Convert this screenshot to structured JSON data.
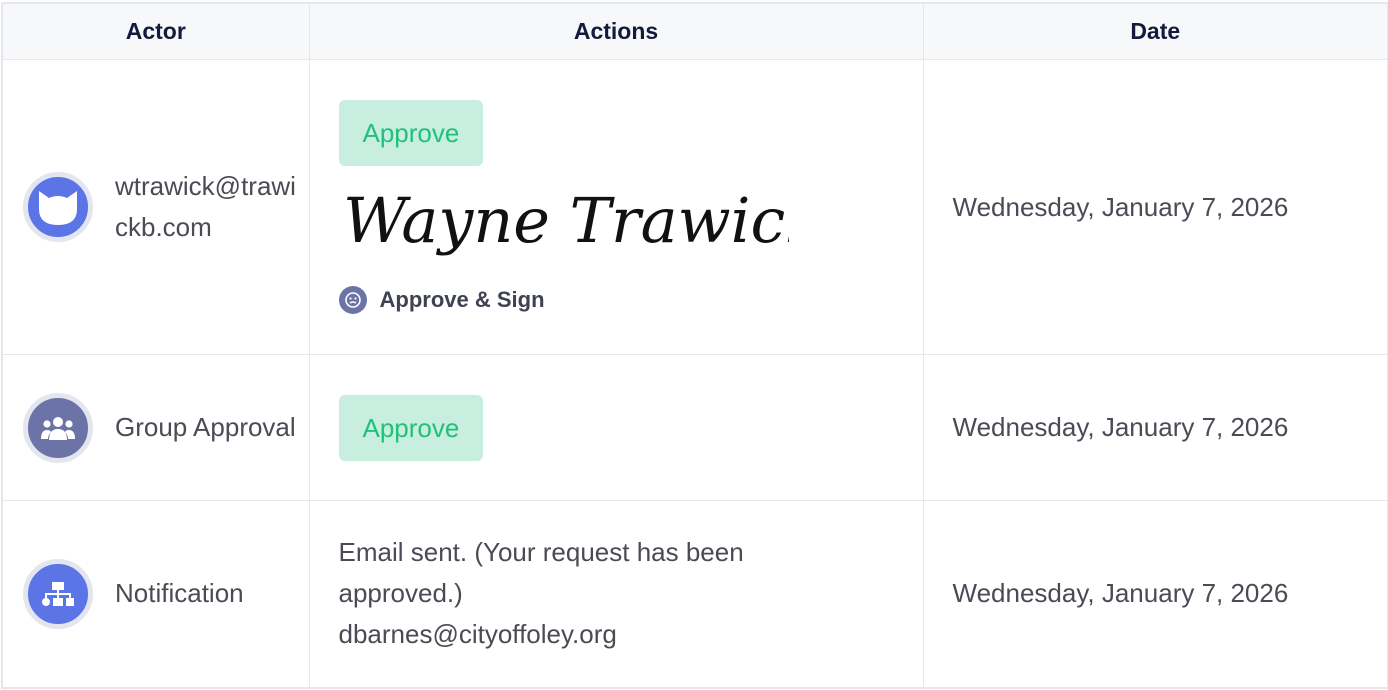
{
  "table": {
    "headers": {
      "actor": "Actor",
      "actions": "Actions",
      "date": "Date"
    },
    "rows": [
      {
        "actor_name": "wtrawick@trawickb.com",
        "actor_icon": "cat-avatar-icon",
        "approve_label": "Approve",
        "signature_text": "Wayne Trawick",
        "approve_sign_label": "Approve & Sign",
        "date": "Wednesday, January 7, 2026"
      },
      {
        "actor_name": "Group Approval",
        "actor_icon": "group-icon",
        "approve_label": "Approve",
        "date": "Wednesday, January 7, 2026"
      },
      {
        "actor_name": "Notification",
        "actor_icon": "sitemap-icon",
        "notification_line1": "Email sent. (Your request has been",
        "notification_line2": "approved.)",
        "notification_line3": "dbarnes@cityoffoley.org",
        "date": "Wednesday, January 7, 2026"
      }
    ]
  },
  "colors": {
    "header_bg": "#f7f8fa",
    "border": "#e6e7ea",
    "approve_bg": "#c7eedf",
    "approve_text": "#22c07a",
    "avatar_blue": "#5b74e6",
    "avatar_slate": "#6c73a6"
  }
}
